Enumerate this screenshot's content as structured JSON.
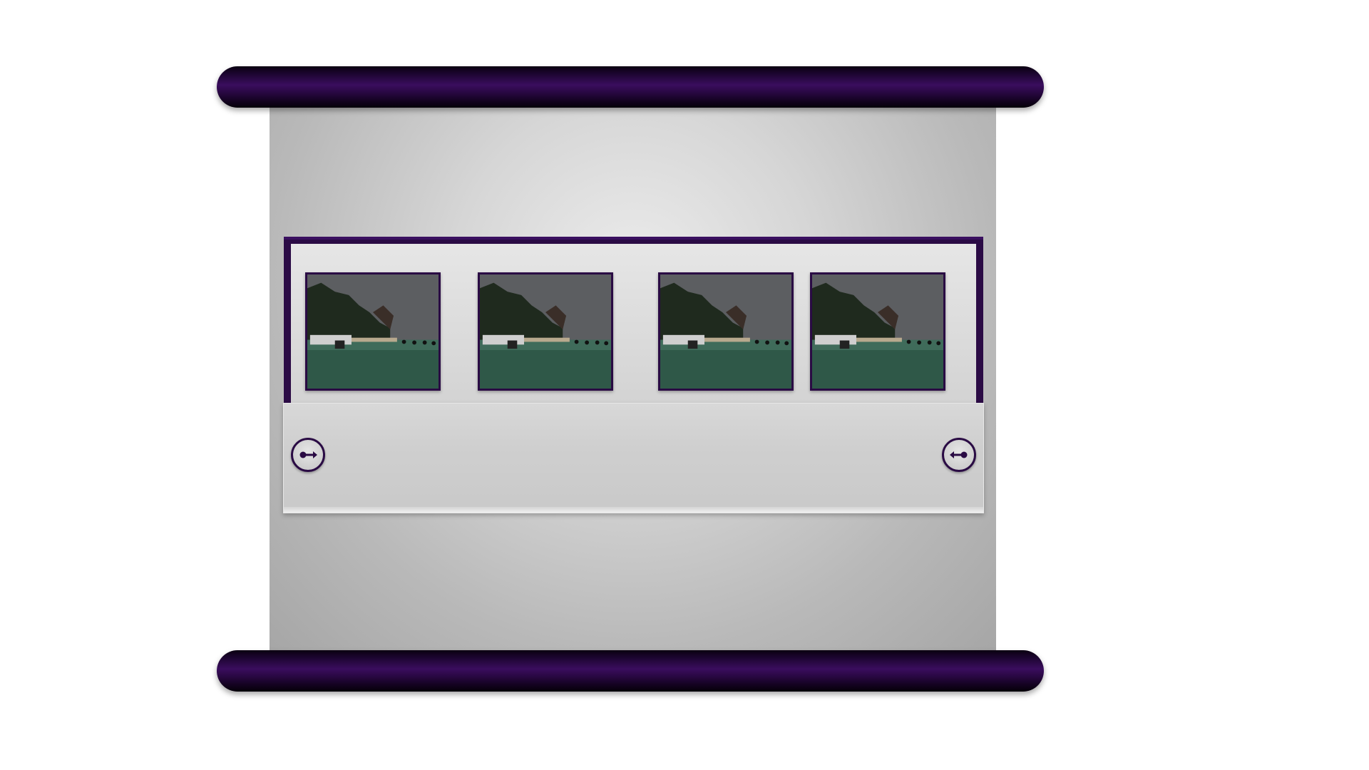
{
  "gallery": {
    "thumbnails": [
      {
        "icon": "beach-boat-photo",
        "selected": false
      },
      {
        "icon": "beach-boat-photo",
        "selected": false
      },
      {
        "icon": "beach-boat-photo",
        "selected": false
      },
      {
        "icon": "beach-boat-photo",
        "selected": false
      }
    ]
  },
  "controls": {
    "prev_icon": "arrow-right-icon",
    "next_icon": "arrow-left-icon"
  },
  "colors": {
    "accent": "#2a0b44",
    "rod": "#1c0530",
    "paper": "#c8c8c8"
  }
}
